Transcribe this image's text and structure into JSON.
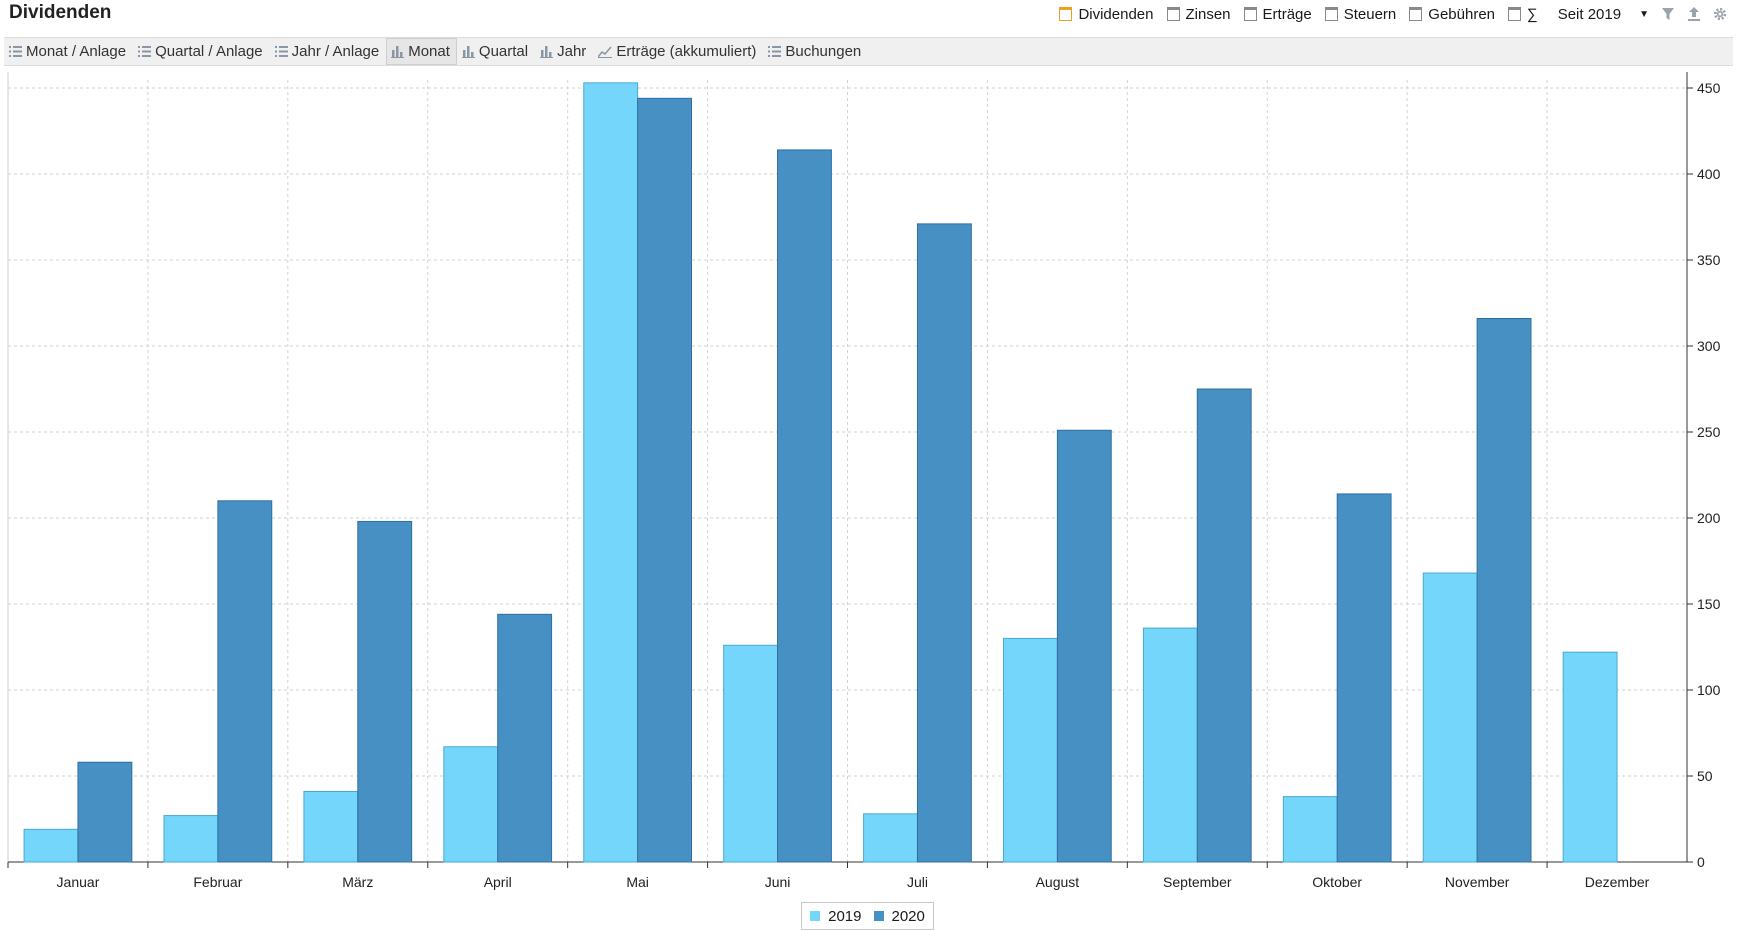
{
  "header": {
    "title": "Dividenden",
    "filters": [
      "Dividenden",
      "Zinsen",
      "Erträge",
      "Steuern",
      "Gebühren",
      "∑"
    ],
    "active_filter": "Dividenden",
    "period": "Seit 2019"
  },
  "tabs": [
    "Monat / Anlage",
    "Quartal / Anlage",
    "Jahr / Anlage",
    "Monat",
    "Quartal",
    "Jahr",
    "Erträge (akkumuliert)",
    "Buchungen"
  ],
  "selected_tab": "Monat",
  "colors": {
    "accent": "#f0a020",
    "series_2019": "#74d6fa",
    "series_2020": "#4790c4"
  },
  "chart_data": {
    "type": "bar",
    "categories": [
      "Januar",
      "Februar",
      "März",
      "April",
      "Mai",
      "Juni",
      "Juli",
      "August",
      "September",
      "Oktober",
      "November",
      "Dezember"
    ],
    "series": [
      {
        "name": "2019",
        "values": [
          19,
          27,
          41,
          67,
          453,
          126,
          28,
          130,
          136,
          38,
          168,
          122
        ]
      },
      {
        "name": "2020",
        "values": [
          58,
          210,
          198,
          144,
          444,
          414,
          371,
          251,
          275,
          214,
          316,
          0
        ]
      }
    ],
    "ylim": [
      0,
      450
    ],
    "yticks": [
      0,
      50,
      100,
      150,
      200,
      250,
      300,
      350,
      400,
      450
    ],
    "y_axis_side": "right",
    "grid": true,
    "legend": "bottom-center"
  }
}
